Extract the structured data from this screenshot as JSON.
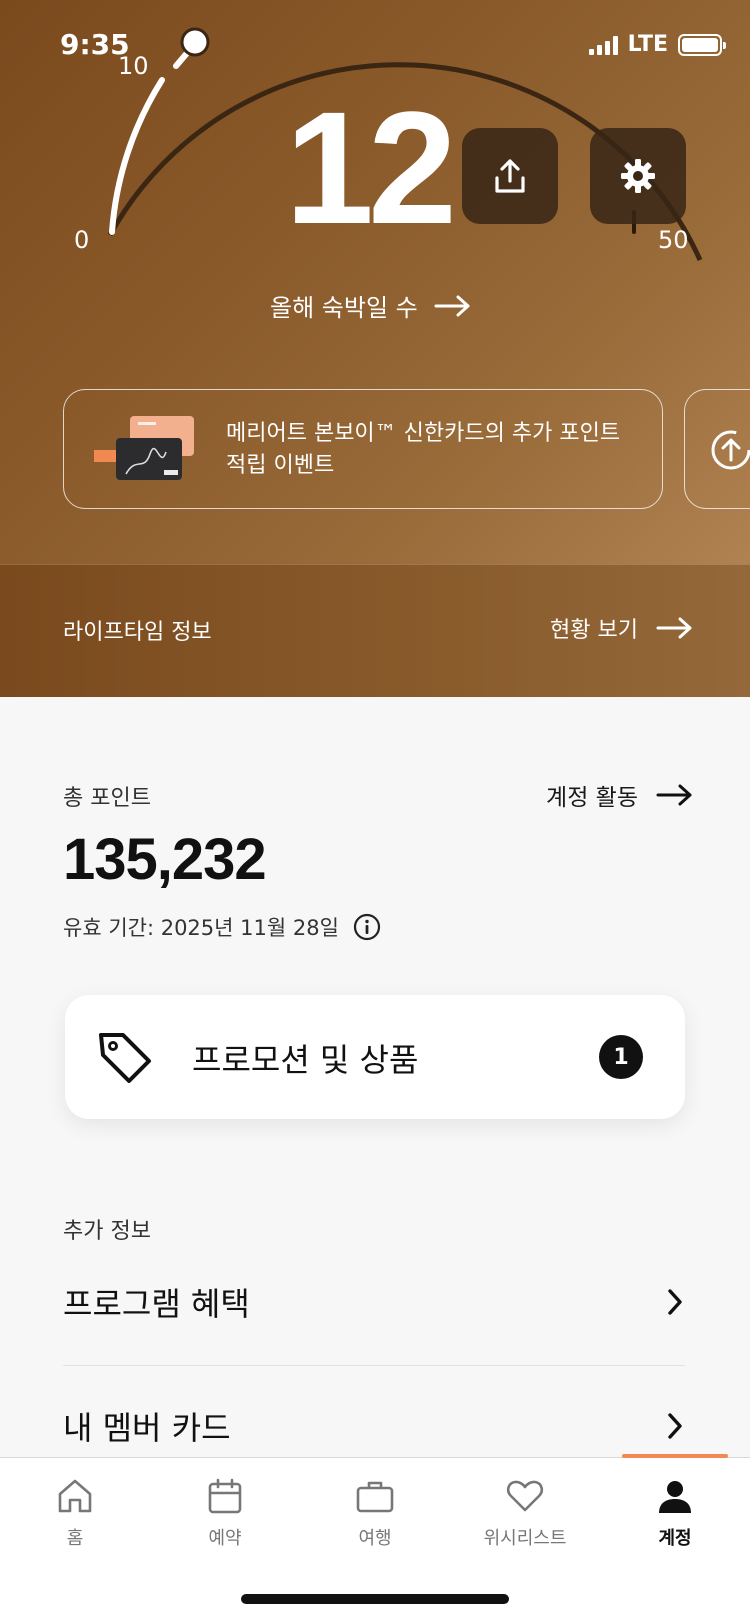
{
  "status": {
    "time": "9:35",
    "network": "LTE"
  },
  "hero": {
    "nights_count": "12",
    "gauge_labels": {
      "min": "0",
      "mark": "10",
      "max": "50"
    },
    "gauge_progress": 0.24,
    "nights_label": "올해 숙박일 수",
    "promo_line1": "메리어트 본보이™ 신한카드의 추가 포인트",
    "promo_line2": "적립 이벤트",
    "lifetime_label": "라이프타임 정보",
    "lifetime_link": "현황 보기"
  },
  "points": {
    "label": "총 포인트",
    "activity_link": "계정 활동",
    "value": "135,232",
    "expiry": "유효 기간: 2025년 11월 28일"
  },
  "promotions": {
    "label": "프로모션 및 상품",
    "count": "1"
  },
  "more_info": {
    "label": "추가 정보",
    "items": [
      {
        "label": "프로그램 혜택"
      },
      {
        "label": "내 멤버 카드"
      }
    ]
  },
  "tabs": [
    {
      "label": "홈",
      "icon": "home-icon"
    },
    {
      "label": "예약",
      "icon": "calendar-icon"
    },
    {
      "label": "여행",
      "icon": "suitcase-icon"
    },
    {
      "label": "위시리스트",
      "icon": "heart-icon"
    },
    {
      "label": "계정",
      "icon": "person-icon",
      "active": true
    }
  ],
  "colors": {
    "hero": "#8a5a2a",
    "accent": "#f08a52",
    "badge": "#111111"
  }
}
